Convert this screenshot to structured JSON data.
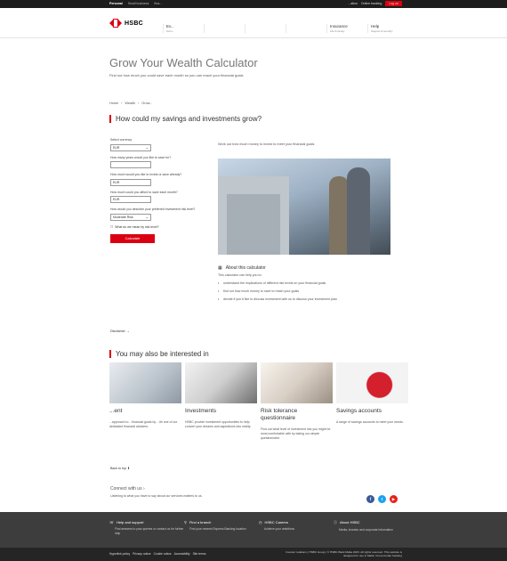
{
  "topbar": {
    "tabs": [
      "Personal",
      "Small business",
      "Bus..."
    ],
    "right_items": [
      "...ation",
      "Online banking"
    ],
    "login": "Log on"
  },
  "header": {
    "brand": "HSBC",
    "nav": [
      {
        "title": "Ev...",
        "sub": "Acco..."
      },
      {
        "title": "",
        "sub": ""
      },
      {
        "title": "",
        "sub": ""
      },
      {
        "title": "",
        "sub": ""
      },
      {
        "title": "Insurance",
        "sub": "Life & family"
      },
      {
        "title": "Help",
        "sub": "Support & security"
      }
    ]
  },
  "hero": {
    "title": "Grow Your Wealth Calculator",
    "subtitle": "Find out how much you could save each month so you can reach your financial goals"
  },
  "breadcrumb": [
    "Home",
    "Wealth",
    "Grow..."
  ],
  "calculator": {
    "title": "How could my savings and investments grow?",
    "fields": [
      {
        "label": "Select currency",
        "value": "EUR",
        "type": "select"
      },
      {
        "label": "How many years would you like to save for?",
        "value": "",
        "type": "input"
      },
      {
        "label": "How much would you like to invest or save already?",
        "value": "EUR",
        "type": "input"
      },
      {
        "label": "How much could you afford to save each month?",
        "value": "EUR",
        "type": "input"
      },
      {
        "label": "How would you describe your preferred investment risk level?",
        "value": "Moderate Risk",
        "type": "select"
      }
    ],
    "risk_link": "What do we mean by risk level?",
    "button": "Calculate",
    "right_intro": "Work out how much money to invest to meet your financial goals"
  },
  "about": {
    "title": "About this calculator",
    "intro": "This calculator can help you to:",
    "bullets": [
      "understand the implications of different risk levels on your financial goals",
      "find out how much money to save to reach your goals",
      "decide if you'd like to discuss investment with us to discuss your investment plan"
    ]
  },
  "disclaimer": "Disclaimer",
  "interest": {
    "title": "You may also be interested in",
    "cards": [
      {
        "title": "...ent",
        "desc": "...approach to ...financial goals by ...ith one of our dedicated financial advisers."
      },
      {
        "title": "Investments",
        "desc": "HSBC provide investment opportunities to help convert your dreams and aspirations into reality."
      },
      {
        "title": "Risk tolerance questionnaire",
        "desc": "Find out what level of investment risk you might be most comfortable with by taking our simple questionnaire."
      },
      {
        "title": "Savings accounts",
        "desc": "A range of savings accounts to meet your needs."
      }
    ]
  },
  "back_to_top": "Back to top",
  "connect": {
    "title": "Connect with us",
    "text": "Listening to what you have to say about our services matters to us."
  },
  "social": [
    {
      "icon": "facebook-icon",
      "glyph": "f",
      "color": "#3b5998"
    },
    {
      "icon": "twitter-icon",
      "glyph": "t",
      "color": "#1da1f2"
    },
    {
      "icon": "youtube-icon",
      "glyph": "▶",
      "color": "#e62117"
    }
  ],
  "footer": {
    "cols": [
      {
        "title": "Help and support",
        "text": "Find answers to your queries or contact us for further help"
      },
      {
        "title": "Find a branch",
        "text": "Find your nearest Express Banking location"
      },
      {
        "title": "HSBC Careers",
        "text": "Achieve your ambitions"
      },
      {
        "title": "About HSBC",
        "text": "Media, investor and corporate information"
      }
    ],
    "links": [
      "Hyperlink policy",
      "Privacy notice",
      "Cookie notice",
      "Accessibility",
      "Site terms"
    ],
    "copyright": "Investor relations | HSBC Group | © HSBC Bank Malta 2023. All rights reserved. This website is designed for use in Malta. Cross-border banking"
  },
  "colors": {
    "accent": "#db0011",
    "dark": "#1d1d1d",
    "footer": "#3d3d3d"
  }
}
